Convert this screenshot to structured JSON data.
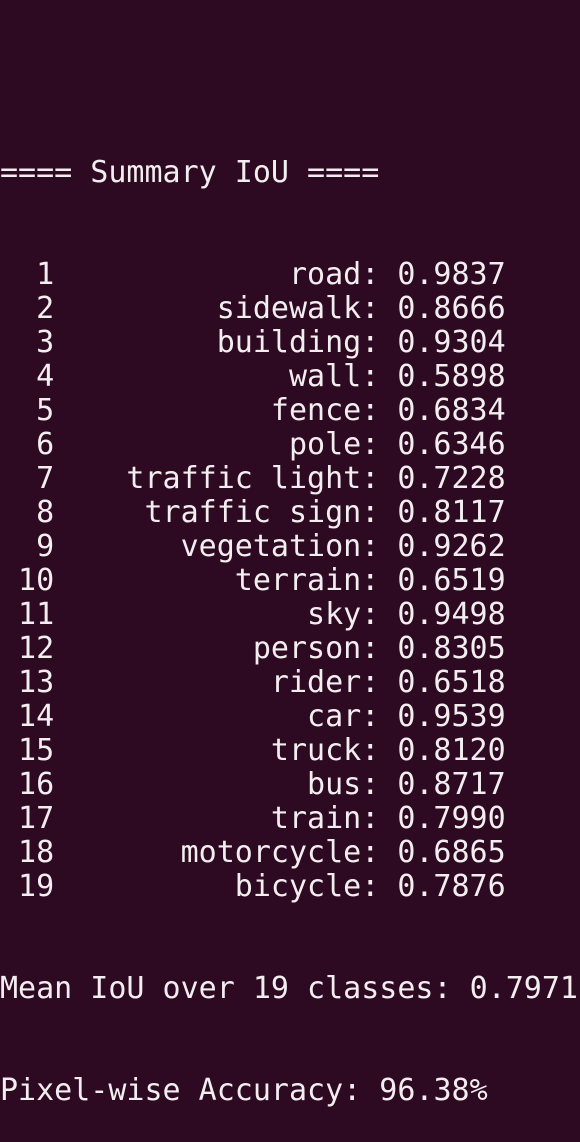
{
  "terminal": {
    "header": "==== Summary IoU ====",
    "rows": [
      {
        "index": "1",
        "label": "road",
        "value": "0.9837"
      },
      {
        "index": "2",
        "label": "sidewalk",
        "value": "0.8666"
      },
      {
        "index": "3",
        "label": "building",
        "value": "0.9304"
      },
      {
        "index": "4",
        "label": "wall",
        "value": "0.5898"
      },
      {
        "index": "5",
        "label": "fence",
        "value": "0.6834"
      },
      {
        "index": "6",
        "label": "pole",
        "value": "0.6346"
      },
      {
        "index": "7",
        "label": "traffic light",
        "value": "0.7228"
      },
      {
        "index": "8",
        "label": "traffic sign",
        "value": "0.8117"
      },
      {
        "index": "9",
        "label": "vegetation",
        "value": "0.9262"
      },
      {
        "index": "10",
        "label": "terrain",
        "value": "0.6519"
      },
      {
        "index": "11",
        "label": "sky",
        "value": "0.9498"
      },
      {
        "index": "12",
        "label": "person",
        "value": "0.8305"
      },
      {
        "index": "13",
        "label": "rider",
        "value": "0.6518"
      },
      {
        "index": "14",
        "label": "car",
        "value": "0.9539"
      },
      {
        "index": "15",
        "label": "truck",
        "value": "0.8120"
      },
      {
        "index": "16",
        "label": "bus",
        "value": "0.8717"
      },
      {
        "index": "17",
        "label": "train",
        "value": "0.7990"
      },
      {
        "index": "18",
        "label": "motorcycle",
        "value": "0.6865"
      },
      {
        "index": "19",
        "label": "bicycle",
        "value": "0.7876"
      }
    ],
    "mean_iou": "Mean IoU over 19 classes: 0.7971",
    "pixel_accuracy": "Pixel-wise Accuracy: 96.38%"
  },
  "colors": {
    "background": "#2e0a22",
    "text": "#f2eef0"
  }
}
